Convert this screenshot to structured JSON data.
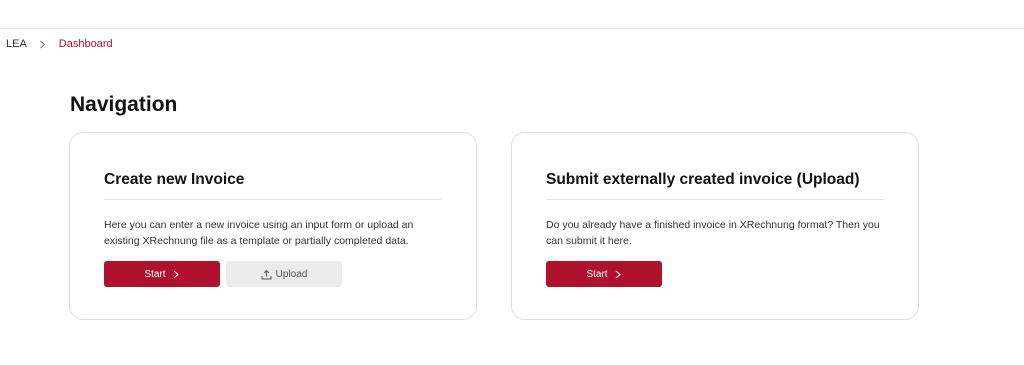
{
  "breadcrumb": {
    "root": "LEA",
    "current": "Dashboard"
  },
  "page": {
    "title": "Navigation"
  },
  "cards": [
    {
      "title": "Create new Invoice",
      "text": "Here you can enter a new invoice using an input form or upload an existing XRechnung file as a template or partially completed data.",
      "primary_label": "Start",
      "secondary_label": "Upload"
    },
    {
      "title": "Submit externally created invoice (Upload)",
      "text": "Do you already have a finished invoice in XRechnung format? Then you can submit it here.",
      "primary_label": "Start"
    }
  ],
  "colors": {
    "accent": "#b0122e",
    "secondary_button": "#ebebeb",
    "card_border": "#dedede"
  },
  "icons": {
    "breadcrumb_separator": "chevron-right-icon",
    "start": "chevron-right-icon",
    "upload": "upload-icon"
  }
}
